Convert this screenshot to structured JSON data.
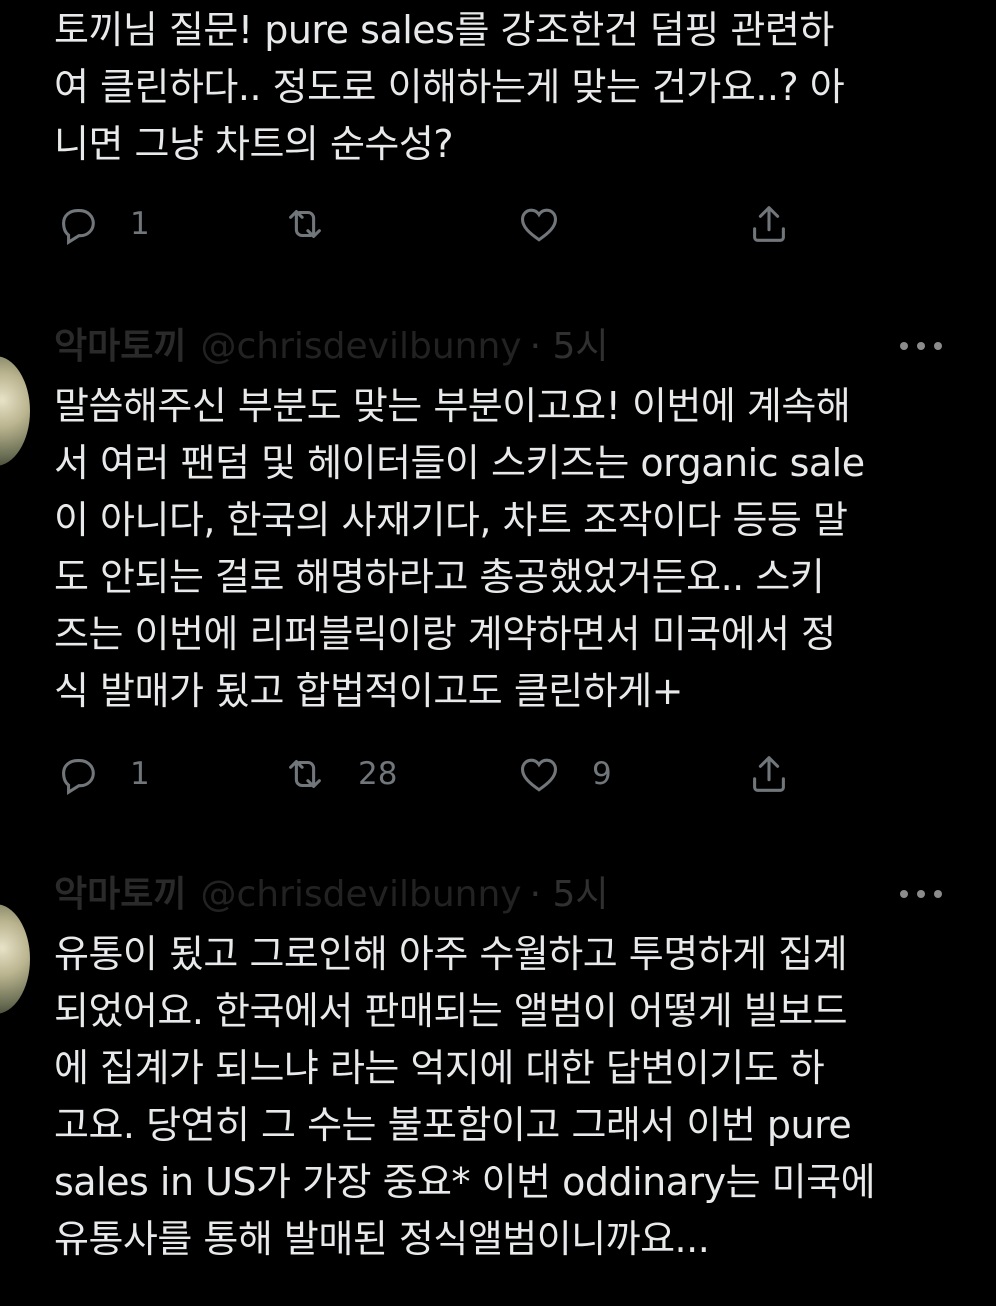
{
  "tweets": [
    {
      "lines": [
        "토끼님 질문! pure sales를 강조한건 덤핑 관련하",
        "여 클린하다.. 정도로 이해하는게 맞는 건가요..? 아",
        "니면 그냥 차트의 순수성?"
      ],
      "actions": {
        "replies": "1",
        "retweets": "",
        "likes": ""
      }
    },
    {
      "author": "악마토끼",
      "handle": "@chrisdevilbunny",
      "time": "· 5시",
      "lines": [
        "말씀해주신 부분도 맞는 부분이고요! 이번에 계속해",
        "서 여러 팬덤 및 헤이터들이 스키즈는 organic sale",
        "이 아니다, 한국의 사재기다, 차트 조작이다 등등 말",
        "도 안되는 걸로 해명하라고 총공했었거든요.. 스키",
        "즈는 이번에 리퍼블릭이랑 계약하면서 미국에서 정",
        "식 발매가 됬고 합법적이고도 클린하게+"
      ],
      "actions": {
        "replies": "1",
        "retweets": "28",
        "likes": "9"
      }
    },
    {
      "author": "악마토끼",
      "handle": "@chrisdevilbunny",
      "time": "· 5시",
      "lines": [
        "유통이 됬고 그로인해 아주 수월하고 투명하게 집계",
        "되었어요. 한국에서 판매되는 앨범이 어떻게 빌보드",
        "에 집계가 되느냐 라는 억지에 대한 답변이기도 하",
        "고요. 당연히 그 수는 불포함이고 그래서 이번 pure",
        "sales in US가 가장 중요* 이번 oddinary는 미국에",
        "유통사를 통해 발매된 정식앨범이니까요..."
      ]
    }
  ],
  "icons": {
    "reply": "reply-icon",
    "retweet": "retweet-icon",
    "like": "heart-icon",
    "share": "share-icon",
    "more": "more-icon"
  },
  "colors": {
    "background": "#000000",
    "text": "#e7e9ea",
    "icon": "#71767b"
  }
}
